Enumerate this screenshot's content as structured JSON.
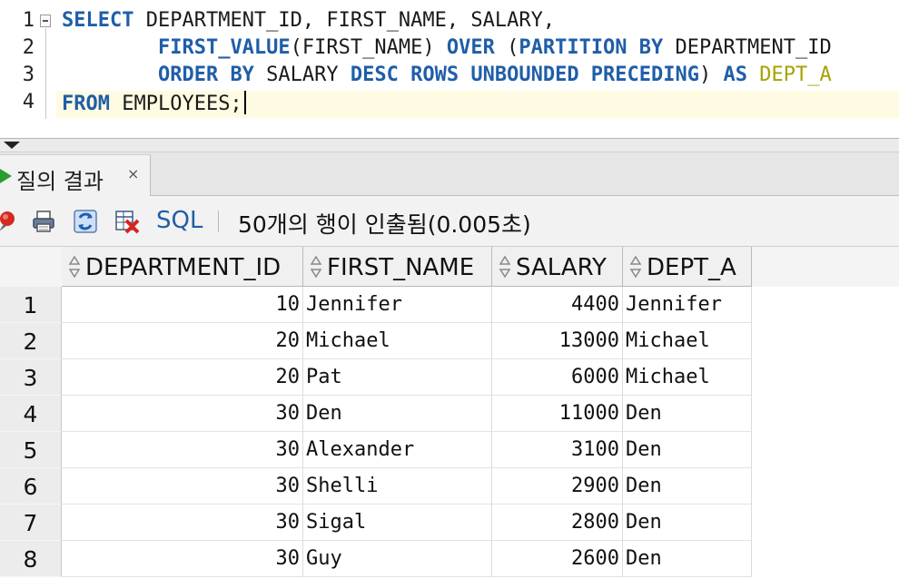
{
  "editor": {
    "line_numbers": [
      "1",
      "2",
      "3",
      "4"
    ],
    "line1": {
      "kw1": "SELECT",
      "t1": " DEPARTMENT_ID, FIRST_NAME, SALARY,"
    },
    "line2": {
      "indent": "        ",
      "kw1": "FIRST_VALUE",
      "t1": "(FIRST_NAME) ",
      "kw2": "OVER",
      "t2": " (",
      "kw3": "PARTITION BY",
      "t3": " DEPARTMENT_ID"
    },
    "line3": {
      "indent": "        ",
      "kw1": "ORDER BY",
      "t1": " SALARY ",
      "kw2": "DESC ROWS UNBOUNDED PRECEDING",
      "t2": ") ",
      "kw3": "AS",
      "t3": " ",
      "alias": "DEPT_A"
    },
    "line4": {
      "kw1": "FROM",
      "t1": " EMPLOYEES;"
    }
  },
  "results_tab": {
    "label": "질의 결과",
    "close": "×"
  },
  "toolbar": {
    "icons": [
      "pin-icon",
      "print-icon",
      "refresh-icon",
      "delete-icon"
    ],
    "sql_label": "SQL",
    "status": "50개의 행이 인출됨(0.005초)"
  },
  "grid": {
    "columns": [
      "DEPARTMENT_ID",
      "FIRST_NAME",
      "SALARY",
      "DEPT_A"
    ],
    "rows": [
      {
        "n": "1",
        "cells": [
          "10",
          "Jennifer",
          "4400",
          "Jennifer"
        ]
      },
      {
        "n": "2",
        "cells": [
          "20",
          "Michael",
          "13000",
          "Michael"
        ]
      },
      {
        "n": "3",
        "cells": [
          "20",
          "Pat",
          "6000",
          "Michael"
        ]
      },
      {
        "n": "4",
        "cells": [
          "30",
          "Den",
          "11000",
          "Den"
        ]
      },
      {
        "n": "5",
        "cells": [
          "30",
          "Alexander",
          "3100",
          "Den"
        ]
      },
      {
        "n": "6",
        "cells": [
          "30",
          "Shelli",
          "2900",
          "Den"
        ]
      },
      {
        "n": "7",
        "cells": [
          "30",
          "Sigal",
          "2800",
          "Den"
        ]
      },
      {
        "n": "8",
        "cells": [
          "30",
          "Guy",
          "2600",
          "Den"
        ]
      }
    ]
  },
  "colors": {
    "keyword": "#1f5ea8",
    "alias": "#a7a200",
    "current_line": "#fffbe3",
    "tab_play": "#2e9b2e"
  }
}
